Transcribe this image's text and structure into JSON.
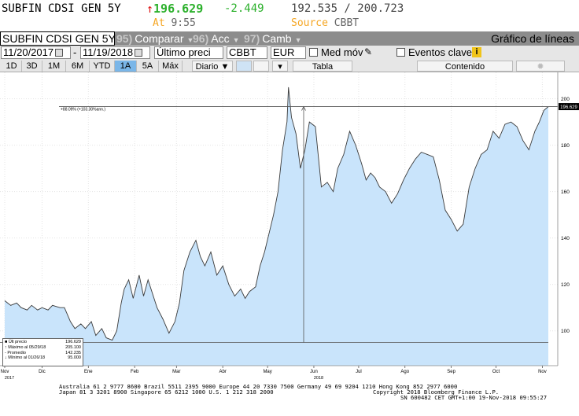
{
  "header": {
    "ticker": "SUBFIN CDSI GEN 5Y",
    "price_arrow": "↑",
    "price": "196.629",
    "change": "-2.449",
    "range": "192.535 / 200.723",
    "at_label": "At",
    "time": "9:55",
    "source_label": "Source",
    "source_value": "CBBT"
  },
  "toolbar": {
    "security": "SUBFIN CDSI GEN 5Y",
    "compare_num": "95)",
    "compare_label": "Comparar",
    "actions_num": "96)",
    "actions_label": "Acc",
    "change_num": "97)",
    "change_label": "Camb",
    "title": "Gráfico de líneas"
  },
  "controls": {
    "start_date": "11/20/2017",
    "date_sep": "-",
    "end_date": "11/19/2018",
    "price_field": "Último preci",
    "source": "CBBT",
    "currency": "EUR",
    "moving_avg_label": "Med móv",
    "key_events_label": "Eventos clave",
    "info_glyph": "i",
    "pencil_glyph": "✎"
  },
  "periods": [
    "1D",
    "3D",
    "1M",
    "6M",
    "YTD",
    "1A",
    "5A",
    "Máx"
  ],
  "active_period": "1A",
  "frequency": "Diario ▼",
  "table_button": "Tabla",
  "content_button": "Contenido",
  "chart_data": {
    "type": "area",
    "title": "",
    "xlabel": "",
    "ylabel": "",
    "ylim": [
      85,
      208
    ],
    "y_ticks": [
      100,
      120,
      140,
      160,
      180,
      200
    ],
    "x_ticks": [
      {
        "label": "Nov",
        "sub": "2017",
        "date": "2017-11-20"
      },
      {
        "label": "Dic",
        "sub": "",
        "date": "2017-12-15"
      },
      {
        "label": "Ene",
        "sub": "",
        "date": "2018-01-15"
      },
      {
        "label": "Feb",
        "sub": "",
        "date": "2018-02-15"
      },
      {
        "label": "Mar",
        "sub": "",
        "date": "2018-03-15"
      },
      {
        "label": "Abr",
        "sub": "",
        "date": "2018-04-15"
      },
      {
        "label": "May",
        "sub": "",
        "date": "2018-05-15"
      },
      {
        "label": "Jun",
        "sub": "2018",
        "date": "2018-06-15"
      },
      {
        "label": "Jul",
        "sub": "",
        "date": "2018-07-15"
      },
      {
        "label": "Ago",
        "sub": "",
        "date": "2018-08-15"
      },
      {
        "label": "Sep",
        "sub": "",
        "date": "2018-09-15"
      },
      {
        "label": "Oct",
        "sub": "",
        "date": "2018-10-15"
      },
      {
        "label": "Nov",
        "sub": "",
        "date": "2018-11-15"
      }
    ],
    "last_price_label": "196.629",
    "annotation": "+88.09% (+103.30%ann.)",
    "ref_low": 95.0,
    "ref_high": 196.629,
    "series": [
      {
        "points": [
          [
            "2017-11-20",
            113
          ],
          [
            "2017-11-24",
            111
          ],
          [
            "2017-11-28",
            112
          ],
          [
            "2017-12-01",
            110
          ],
          [
            "2017-12-05",
            109
          ],
          [
            "2017-12-08",
            111
          ],
          [
            "2017-12-12",
            109
          ],
          [
            "2017-12-15",
            110
          ],
          [
            "2017-12-19",
            109
          ],
          [
            "2017-12-22",
            111
          ],
          [
            "2017-12-27",
            110
          ],
          [
            "2017-12-30",
            110
          ],
          [
            "2018-01-03",
            104
          ],
          [
            "2018-01-06",
            101
          ],
          [
            "2018-01-10",
            103
          ],
          [
            "2018-01-13",
            101
          ],
          [
            "2018-01-17",
            104
          ],
          [
            "2018-01-20",
            98
          ],
          [
            "2018-01-24",
            101
          ],
          [
            "2018-01-27",
            97
          ],
          [
            "2018-01-31",
            96
          ],
          [
            "2018-02-03",
            100
          ],
          [
            "2018-02-06",
            112
          ],
          [
            "2018-02-08",
            118
          ],
          [
            "2018-02-11",
            122
          ],
          [
            "2018-02-14",
            114
          ],
          [
            "2018-02-18",
            124
          ],
          [
            "2018-02-21",
            115
          ],
          [
            "2018-02-24",
            122
          ],
          [
            "2018-02-27",
            116
          ],
          [
            "2018-03-02",
            110
          ],
          [
            "2018-03-06",
            105
          ],
          [
            "2018-03-10",
            99
          ],
          [
            "2018-03-14",
            104
          ],
          [
            "2018-03-17",
            112
          ],
          [
            "2018-03-20",
            126
          ],
          [
            "2018-03-24",
            134
          ],
          [
            "2018-03-28",
            139
          ],
          [
            "2018-03-31",
            132
          ],
          [
            "2018-04-03",
            128
          ],
          [
            "2018-04-07",
            134
          ],
          [
            "2018-04-11",
            124
          ],
          [
            "2018-04-15",
            128
          ],
          [
            "2018-04-19",
            120
          ],
          [
            "2018-04-23",
            115
          ],
          [
            "2018-04-27",
            118
          ],
          [
            "2018-04-30",
            114
          ],
          [
            "2018-05-03",
            117
          ],
          [
            "2018-05-07",
            119
          ],
          [
            "2018-05-10",
            128
          ],
          [
            "2018-05-13",
            134
          ],
          [
            "2018-05-16",
            142
          ],
          [
            "2018-05-19",
            150
          ],
          [
            "2018-05-22",
            160
          ],
          [
            "2018-05-25",
            178
          ],
          [
            "2018-05-28",
            190
          ],
          [
            "2018-05-29",
            205
          ],
          [
            "2018-05-31",
            192
          ],
          [
            "2018-06-03",
            185
          ],
          [
            "2018-06-06",
            170
          ],
          [
            "2018-06-09",
            178
          ],
          [
            "2018-06-12",
            190
          ],
          [
            "2018-06-16",
            188
          ],
          [
            "2018-06-20",
            162
          ],
          [
            "2018-06-24",
            164
          ],
          [
            "2018-06-28",
            160
          ],
          [
            "2018-07-01",
            170
          ],
          [
            "2018-07-05",
            176
          ],
          [
            "2018-07-09",
            186
          ],
          [
            "2018-07-13",
            180
          ],
          [
            "2018-07-17",
            172
          ],
          [
            "2018-07-20",
            165
          ],
          [
            "2018-07-23",
            168
          ],
          [
            "2018-07-26",
            166
          ],
          [
            "2018-07-29",
            162
          ],
          [
            "2018-08-02",
            160
          ],
          [
            "2018-08-06",
            155
          ],
          [
            "2018-08-10",
            159
          ],
          [
            "2018-08-14",
            165
          ],
          [
            "2018-08-18",
            170
          ],
          [
            "2018-08-22",
            174
          ],
          [
            "2018-08-26",
            177
          ],
          [
            "2018-08-30",
            176
          ],
          [
            "2018-09-03",
            175
          ],
          [
            "2018-09-07",
            165
          ],
          [
            "2018-09-11",
            152
          ],
          [
            "2018-09-15",
            148
          ],
          [
            "2018-09-19",
            143
          ],
          [
            "2018-09-23",
            146
          ],
          [
            "2018-09-27",
            162
          ],
          [
            "2018-10-01",
            170
          ],
          [
            "2018-10-05",
            176
          ],
          [
            "2018-10-09",
            178
          ],
          [
            "2018-10-13",
            186
          ],
          [
            "2018-10-17",
            183
          ],
          [
            "2018-10-21",
            189
          ],
          [
            "2018-10-25",
            190
          ],
          [
            "2018-10-29",
            188
          ],
          [
            "2018-11-02",
            182
          ],
          [
            "2018-11-06",
            178
          ],
          [
            "2018-11-10",
            186
          ],
          [
            "2018-11-13",
            190
          ],
          [
            "2018-11-16",
            195
          ],
          [
            "2018-11-19",
            196.6
          ]
        ]
      }
    ]
  },
  "legend": {
    "rows": [
      {
        "label": "Últ precio",
        "value": "196.629"
      },
      {
        "label": "Máximo al 05/29/18",
        "value": "205.100"
      },
      {
        "label": "Promedio",
        "value": "142.235"
      },
      {
        "label": "Mínimo al 01/26/18",
        "value": "95.000"
      }
    ]
  },
  "footer": {
    "line1": "Australia 61 2 9777 8600 Brazil 5511 2395 9000 Europe 44 20 7330 7500 Germany 49 69 9204 1210 Hong Kong 852 2977 6000",
    "line2": "Japan 81 3 3201 8900        Singapore 65 6212 1000        U.S. 1 212 318 2000",
    "line3": "Copyright 2018 Bloomberg Finance L.P.",
    "line4": "SN 600482 CET  GMT+1:00 19-Nov-2018 09:55:27"
  },
  "colors": {
    "area_fill": "#c9e4fb",
    "line": "#3a3a3a",
    "up": "#2bb02b",
    "accent_orange": "#f5a623",
    "toolbar_gray": "#8c8c8c",
    "active_blue": "#7ab6e8"
  }
}
